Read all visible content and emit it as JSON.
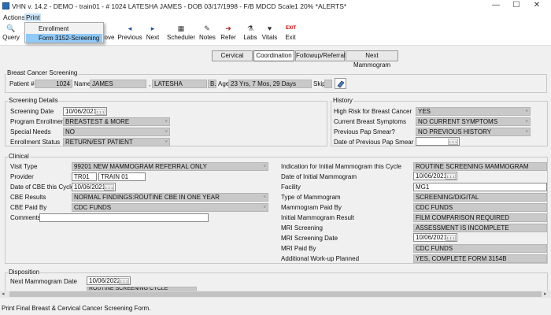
{
  "window": {
    "title": "VHN v. 14.2 - DEMO - train01 - # 1024  LATESHA JAMES  - DOB 03/17/1998 - F/B MDCD  Scale1  20% *ALERTS*",
    "minimize": "—",
    "maximize": "☐",
    "close": "✕"
  },
  "menu": {
    "actions": "Actions",
    "print": "Print"
  },
  "print_menu": {
    "items": [
      "Enrollment",
      "Form 3152-Screening"
    ],
    "highlighted": 1
  },
  "toolbar": {
    "query": "Query",
    "remove": "ove",
    "previous": "Previous",
    "next": "Next",
    "scheduler": "Scheduler",
    "notes": "Notes",
    "refer": "Refer",
    "labs": "Labs",
    "vitals": "Vitals",
    "exit": "Exit",
    "exit_icon_text": "EXIT"
  },
  "tabs": [
    "Cervical",
    "Coordination",
    "Followup/Referral",
    "Next Mammogram"
  ],
  "selected_tab": 1,
  "bcs": {
    "group_label": "Breast Cancer Screening",
    "patient_label": "Patient #",
    "patient_num": "1024",
    "name_label": "Name",
    "last": "JAMES",
    "comma": ",",
    "first": "LATESHA",
    "mi": "B.",
    "age_label": "Age",
    "age": "23 Yrs,  7 Mos, 29 Days",
    "skip_label": "Skip"
  },
  "screening": {
    "group_label": "Screening Details",
    "date_label": "Screening Date",
    "date": "10/06/2021",
    "program_label": "Program Enrollment",
    "program": "BREASTEST & MORE",
    "special_label": "Special Needs",
    "special": "NO",
    "status_label": "Enrollment Status",
    "status": "RETURN/EST PATIENT"
  },
  "history": {
    "group_label": "History",
    "risk_label": "High Risk for Breast Cancer",
    "risk": "YES",
    "symptoms_label": "Current Breast Symptoms",
    "symptoms": "NO CURRENT SYMPTOMS",
    "pap_label": "Previous Pap Smear?",
    "pap": "NO PREVIOUS HISTORY",
    "papdate_label": "Date of Previous Pap Smear",
    "papdate": ""
  },
  "clinical": {
    "group_label": "Clinical",
    "visit_type_label": "Visit Type",
    "visit_type": "99201 NEW MAMMOGRAM REFERRAL ONLY",
    "provider_label": "Provider",
    "provider_code": "TR01",
    "provider_name": "TRAIN 01",
    "cbe_date_label": "Date of CBE this Cycle",
    "cbe_date": "10/06/2021",
    "cbe_results_label": "CBE Results",
    "cbe_results": "NORMAL FINDINGS:ROUTINE CBE IN ONE YEAR",
    "cbe_paid_label": "CBE Paid By",
    "cbe_paid": "CDC FUNDS",
    "comments_label": "Comments",
    "comments": "",
    "indication_label": "Indication for Initial Mammogram this Cycle",
    "indication": "ROUTINE SCREENING MAMMOGRAM",
    "init_mammo_date_label": "Date of Initial Mammogram",
    "init_mammo_date": "10/06/2021",
    "facility_label": "Facility",
    "facility": "MG1",
    "mammo_type_label": "Type of Mammogram",
    "mammo_type": "SCREENING/DIGITAL",
    "mammo_paid_label": "Mammogram Paid By",
    "mammo_paid": "CDC FUNDS",
    "init_result_label": "Initial Mammogram Result",
    "init_result": "FILM COMPARISON REQUIRED",
    "mri_label": "MRI Screening",
    "mri": "ASSESSMENT IS INCOMPLETE",
    "mri_date_label": "MRI Screening Date",
    "mri_date": "10/06/2021",
    "mri_paid_label": "MRI Paid By",
    "mri_paid": "CDC FUNDS",
    "addl_label": "Additional Work-up Planned",
    "addl": "YES, COMPLETE FORM 3154B"
  },
  "disposition": {
    "group_label": "Disposition",
    "next_date_label": "Next Mammogram Date",
    "next_date": "10/06/2022",
    "cycle": "ROUTINE SCREENING CYCLE"
  },
  "status_bar": "Print Final Breast & Cervical Cancer Screening Form.",
  "icons": {
    "calendar_text": "1 1 1",
    "dropdown_arrow": "˅",
    "left_arrow": "◂",
    "right_arrow": "▸"
  }
}
